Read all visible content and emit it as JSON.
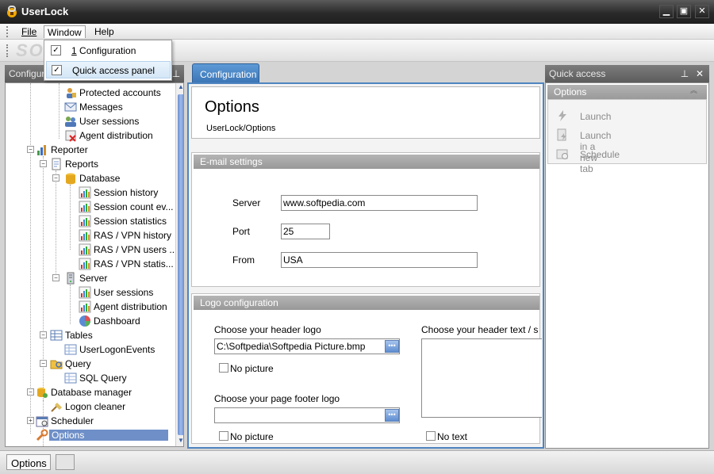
{
  "app": {
    "title": "UserLock"
  },
  "menu": {
    "file": "File",
    "window": "Window",
    "help": "Help"
  },
  "window_menu": {
    "items": [
      {
        "prefix": "1",
        "label": " Configuration",
        "checked": true
      },
      {
        "label": "Quick access panel",
        "checked": true
      }
    ]
  },
  "left_panel": {
    "title": "Configuration",
    "tree": [
      {
        "label": "Protected accounts",
        "icon": "protected-accounts-icon"
      },
      {
        "label": "Messages",
        "icon": "messages-icon"
      },
      {
        "label": "User sessions",
        "icon": "user-sessions-icon"
      },
      {
        "label": "Agent distribution",
        "icon": "agent-distribution-icon"
      },
      {
        "label": "Reporter",
        "icon": "reporter-icon"
      },
      {
        "label": "Reports",
        "icon": "reports-icon"
      },
      {
        "label": "Database",
        "icon": "database-icon"
      },
      {
        "label": "Session history",
        "icon": "report-chart-icon"
      },
      {
        "label": "Session count ev...",
        "icon": "report-chart-icon"
      },
      {
        "label": "Session statistics",
        "icon": "report-chart-icon"
      },
      {
        "label": "RAS / VPN history",
        "icon": "report-chart-icon"
      },
      {
        "label": "RAS / VPN users ...",
        "icon": "report-chart-icon"
      },
      {
        "label": "RAS / VPN statis...",
        "icon": "report-chart-icon"
      },
      {
        "label": "Server",
        "icon": "server-icon"
      },
      {
        "label": "User sessions",
        "icon": "report-chart-icon"
      },
      {
        "label": "Agent distribution",
        "icon": "report-chart-icon"
      },
      {
        "label": "Dashboard",
        "icon": "dashboard-icon"
      },
      {
        "label": "Tables",
        "icon": "tables-icon"
      },
      {
        "label": "UserLogonEvents",
        "icon": "table-icon"
      },
      {
        "label": "Query",
        "icon": "query-icon"
      },
      {
        "label": "SQL Query",
        "icon": "table-icon"
      },
      {
        "label": "Database manager",
        "icon": "database-manager-icon"
      },
      {
        "label": "Logon cleaner",
        "icon": "logon-cleaner-icon"
      },
      {
        "label": "Scheduler",
        "icon": "scheduler-icon"
      },
      {
        "label": "Options",
        "icon": "options-wrench-icon",
        "selected": true
      }
    ]
  },
  "main": {
    "tab": "Configuration",
    "title": "Options",
    "path": "UserLock/Options",
    "email": {
      "header": "E-mail settings",
      "server_label": "Server",
      "server_value": "www.softpedia.com",
      "port_label": "Port",
      "port_value": "25",
      "from_label": "From",
      "from_value": "USA"
    },
    "logo": {
      "header": "Logo configuration",
      "header_logo_label": "Choose your header logo",
      "header_logo_value": "C:\\Softpedia\\Softpedia Picture.bmp",
      "no_picture_1": "No picture",
      "footer_logo_label": "Choose your page footer logo",
      "footer_logo_value": "",
      "no_picture_2": "No picture",
      "header_text_label": "Choose your header text / slog",
      "no_text": "No text"
    }
  },
  "quick_access": {
    "title": "Quick access",
    "section": "Options",
    "items": [
      {
        "label": "Launch",
        "icon": "launch-icon"
      },
      {
        "label": "Launch in a new tab",
        "icon": "launch-new-tab-icon"
      },
      {
        "label": "Schedule",
        "icon": "schedule-icon"
      }
    ]
  },
  "status": {
    "options_tab": "Options"
  },
  "watermark": "SOFT"
}
